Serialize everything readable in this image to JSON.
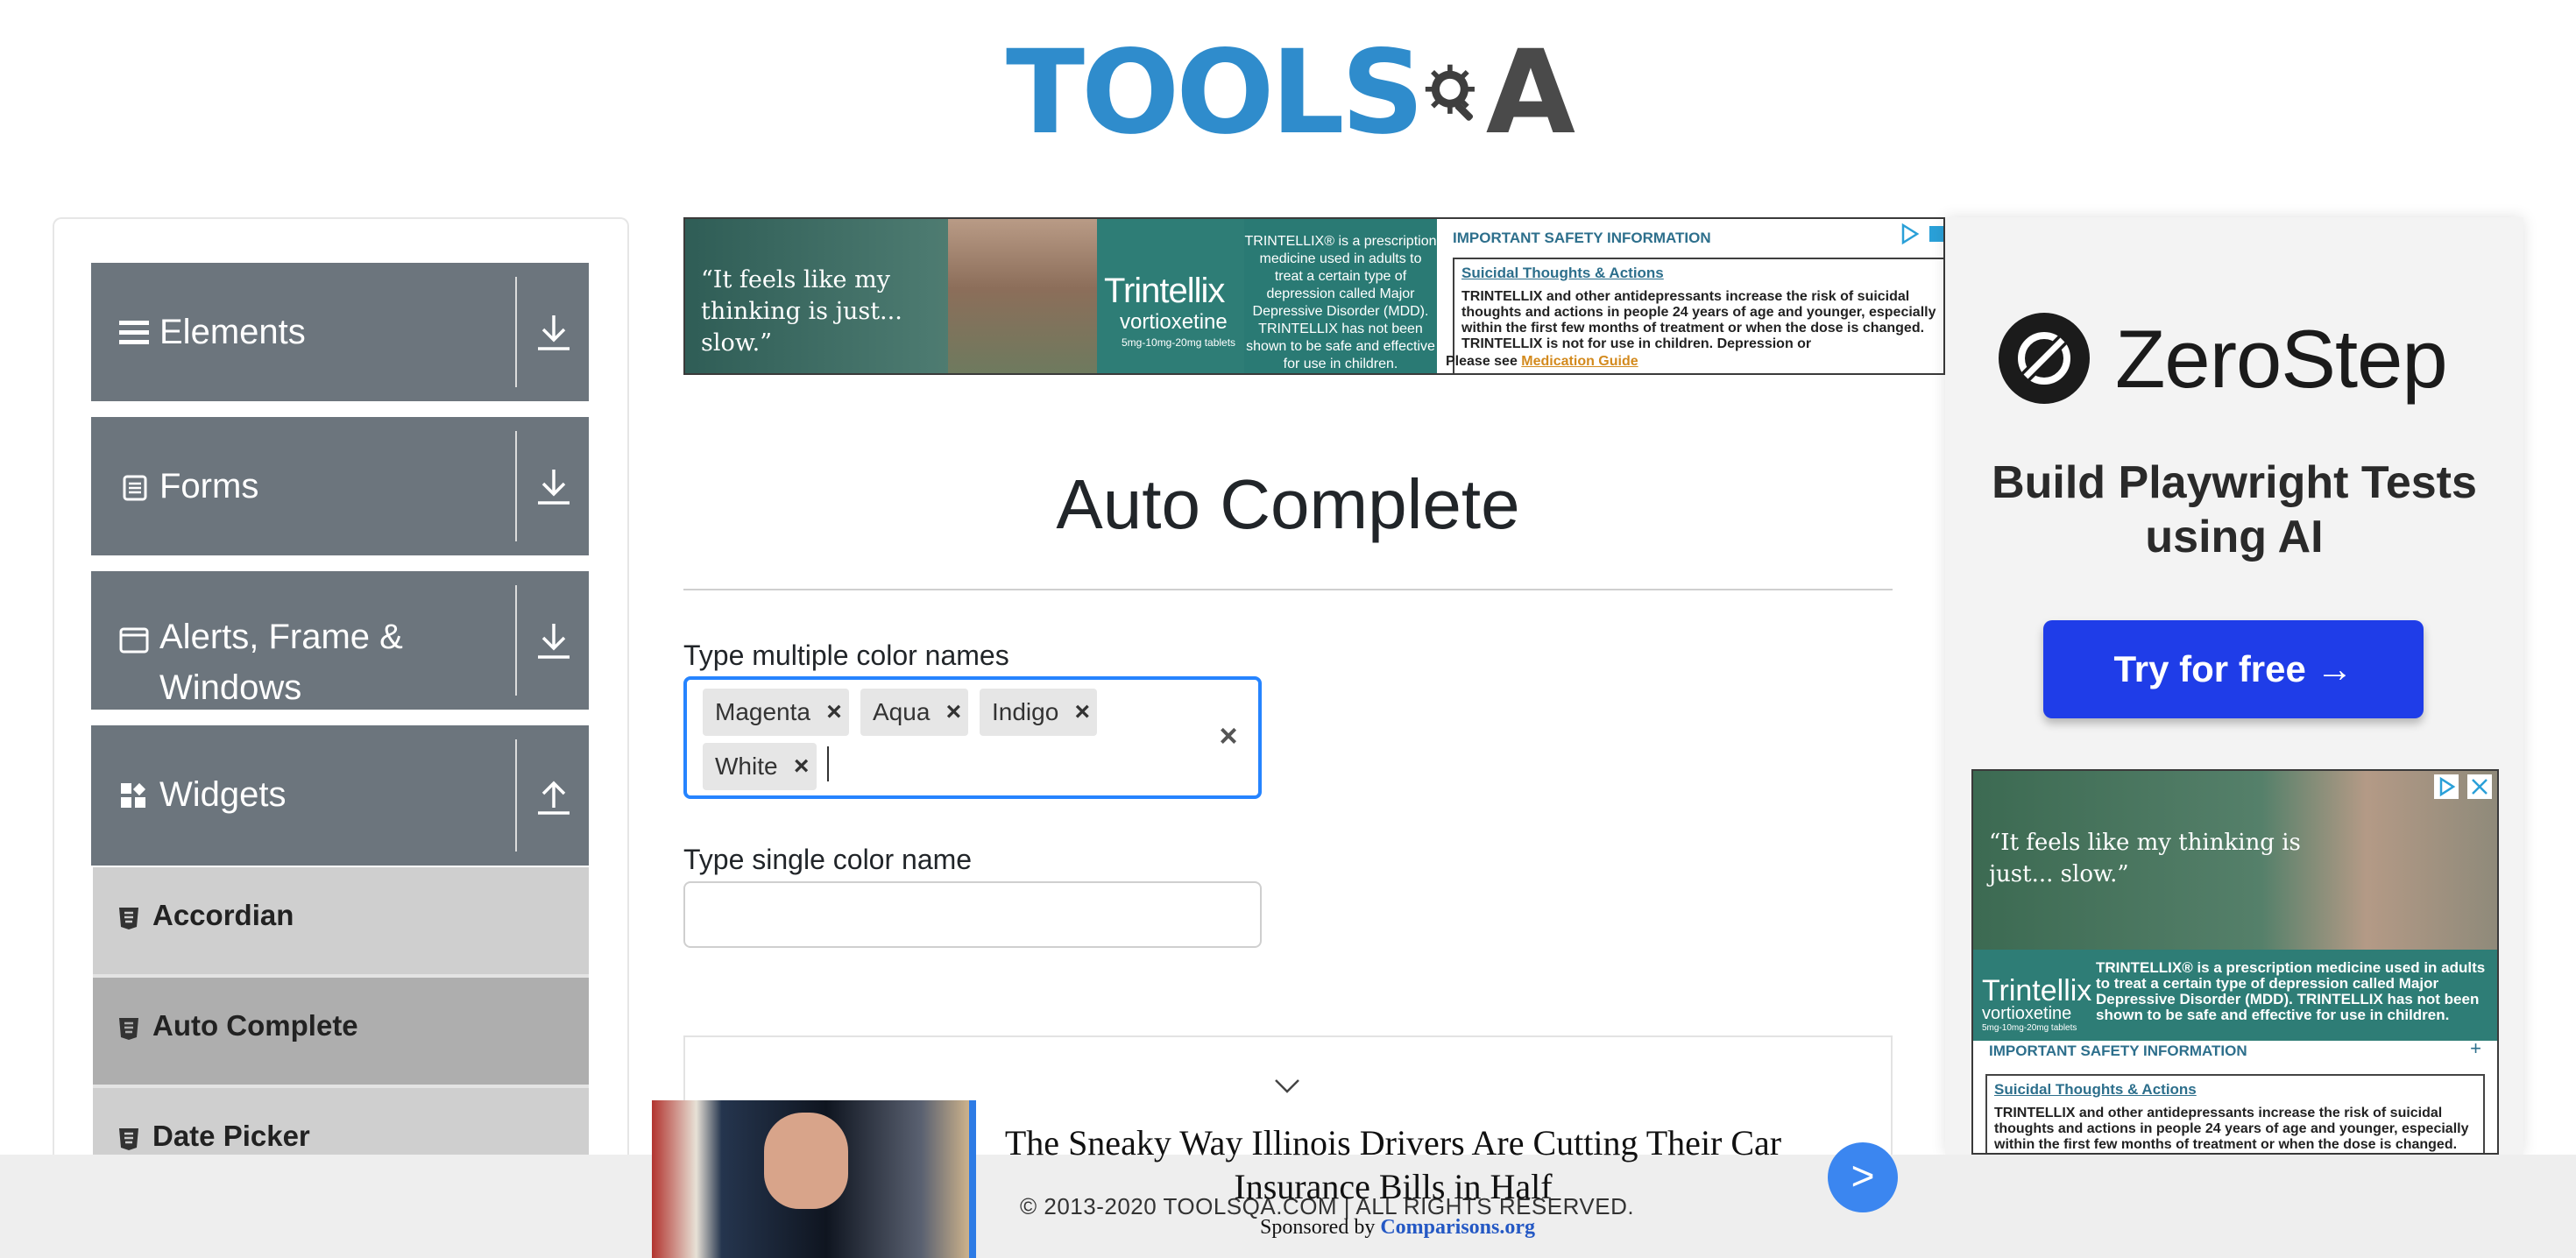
{
  "logo": {
    "text_tools": "TOOLS",
    "text_q": "Q",
    "text_a": "A"
  },
  "sidebar": {
    "groups": [
      {
        "label": "Elements",
        "icon": "hamburger-icon",
        "arrow": "download-arrow-icon"
      },
      {
        "label": "Forms",
        "icon": "form-icon",
        "arrow": "download-arrow-icon"
      },
      {
        "label": "Alerts, Frame & Windows",
        "icon": "window-icon",
        "arrow": "download-arrow-icon"
      },
      {
        "label": "Widgets",
        "icon": "widgets-icon",
        "arrow": "upload-arrow-icon"
      }
    ],
    "items": [
      {
        "label": "Accordian",
        "active": false
      },
      {
        "label": "Auto Complete",
        "active": true
      },
      {
        "label": "Date Picker",
        "active": false
      }
    ]
  },
  "top_ad": {
    "quote": "“It feels like my thinking is just... slow.”",
    "brand": "Trintellix",
    "generic": "vortioxetine",
    "dose": "5mg-10mg-20mg tablets",
    "desc": "TRINTELLIX® is a prescription medicine used in adults to treat a certain type of depression called Major Depressive Disorder (MDD). TRINTELLIX has not been shown to be safe and effective for use in children.",
    "isi_title": "IMPORTANT SAFETY INFORMATION",
    "subhead": "Suicidal Thoughts & Actions",
    "body": "TRINTELLIX and other antidepressants increase the risk of suicidal thoughts and actions in people 24 years of age and younger, especially within the first few months of treatment or when the dose is changed. TRINTELLIX is not for use in children. Depression or",
    "see_prefix": "Please see ",
    "see_link": "Medication Guide"
  },
  "main": {
    "title": "Auto Complete",
    "multi_label": "Type multiple color names",
    "chips": [
      "Magenta",
      "Aqua",
      "Indigo",
      "White"
    ],
    "chip_remove": "×",
    "clear": "×",
    "single_label": "Type single color name",
    "single_value": ""
  },
  "right_ad": {
    "brand": "ZeroStep",
    "tagline": "Build Playwright Tests using AI",
    "cta": "Try for free →"
  },
  "right_ad2": {
    "quote": "“It feels like my thinking is just... slow.”",
    "brand": "Trintellix",
    "generic": "vortioxetine",
    "dose": "5mg-10mg-20mg tablets",
    "desc": "TRINTELLIX® is a prescription medicine used in adults to treat a certain type of depression called Major Depressive Disorder (MDD). TRINTELLIX has not been shown to be safe and effective for use in children.",
    "isi_title": "IMPORTANT SAFETY INFORMATION",
    "plus": "+",
    "subhead": "Suicidal Thoughts & Actions",
    "body": "TRINTELLIX and other antidepressants increase the risk of suicidal thoughts and actions in people 24 years of age and younger, especially within the first few months of treatment or when the dose is changed. TRINTELLIX is not for use in children. Depression or"
  },
  "footer": {
    "copyright": "© 2013-2020 TOOLSQA.COM | ALL RIGHTS RESERVED."
  },
  "bottom_ad": {
    "headline": "The Sneaky Way Illinois Drivers Are Cutting Their Car Insurance Bills in Half",
    "sponsored_prefix": "Sponsored by ",
    "sponsor": "Comparisons.org",
    "button": ">"
  },
  "colors": {
    "accent": "#2684ff",
    "sidebar_group": "#6c757d",
    "sidebar_item": "#cfcfcf",
    "sidebar_item_active": "#aeaeae",
    "logo_blue": "#2f8ccc",
    "zerostep_button": "#1f3de8"
  }
}
